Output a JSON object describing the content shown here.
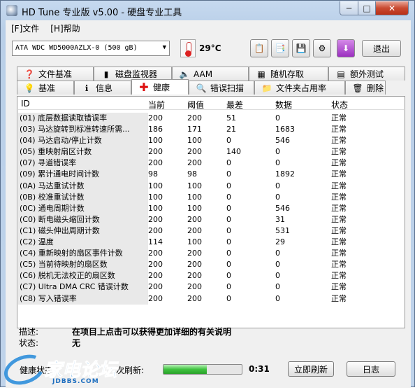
{
  "window": {
    "title": "HD Tune 专业版 v5.00 - 硬盘专业工具",
    "min": "─",
    "max": "□",
    "close": "✕"
  },
  "menu": {
    "file": "[F]文件",
    "help": "[H]帮助"
  },
  "toolbar": {
    "drive": "ATA    WDC WD5000AZLX-0 (500 gB)",
    "temperature": "29°C",
    "exit_label": "退出",
    "icons": [
      "copy-icon",
      "copy-info-icon",
      "save-icon",
      "settings-icon",
      "download-icon"
    ]
  },
  "tabs_top": [
    "文件基准",
    "磁盘监视器",
    "AAM",
    "随机存取",
    "额外测试"
  ],
  "tabs_bottom": [
    "基准",
    "信息",
    "健康",
    "错误扫描",
    "文件夹占用率",
    "删除"
  ],
  "active_tab": "健康",
  "table": {
    "columns": [
      "ID",
      "当前",
      "阈值",
      "最差",
      "数据",
      "状态"
    ],
    "rows": [
      [
        "(01) 底层数据读取错误率",
        "200",
        "200",
        "51",
        "0",
        "正常"
      ],
      [
        "(03) 马达旋转到标准转速所需...",
        "186",
        "171",
        "21",
        "1683",
        "正常"
      ],
      [
        "(04) 马达启动/停止计数",
        "100",
        "100",
        "0",
        "546",
        "正常"
      ],
      [
        "(05) 重映射扇区计数",
        "200",
        "200",
        "140",
        "0",
        "正常"
      ],
      [
        "(07) 寻道错误率",
        "200",
        "200",
        "0",
        "0",
        "正常"
      ],
      [
        "(09) 累计通电时间计数",
        "98",
        "98",
        "0",
        "1892",
        "正常"
      ],
      [
        "(0A) 马达重试计数",
        "100",
        "100",
        "0",
        "0",
        "正常"
      ],
      [
        "(0B) 校准重试计数",
        "100",
        "100",
        "0",
        "0",
        "正常"
      ],
      [
        "(0C) 通电周期计数",
        "100",
        "100",
        "0",
        "546",
        "正常"
      ],
      [
        "(C0) 断电磁头缩回计数",
        "200",
        "200",
        "0",
        "31",
        "正常"
      ],
      [
        "(C1) 磁头伸出周期计数",
        "200",
        "200",
        "0",
        "531",
        "正常"
      ],
      [
        "(C2) 温度",
        "114",
        "100",
        "0",
        "29",
        "正常"
      ],
      [
        "(C4) 重新映射的扇区事件计数",
        "200",
        "200",
        "0",
        "0",
        "正常"
      ],
      [
        "(C5) 当前待映射的扇区数",
        "200",
        "200",
        "0",
        "0",
        "正常"
      ],
      [
        "(C6) 脱机无法校正的扇区数",
        "200",
        "200",
        "0",
        "0",
        "正常"
      ],
      [
        "(C7) Ultra DMA CRC 错误计数",
        "200",
        "200",
        "0",
        "0",
        "正常"
      ],
      [
        "(C8) 写入错误率",
        "200",
        "200",
        "0",
        "0",
        "正常"
      ]
    ]
  },
  "description": {
    "label": "描述:",
    "value": "在项目上点击可以获得更加详细的有关说明"
  },
  "state": {
    "label": "状态:",
    "value": "无"
  },
  "status_bar": {
    "health_label": "健康状态",
    "next_refresh_label": "次刷新:",
    "progress": 0.55,
    "countdown": "0:31",
    "refresh_now": "立即刷新",
    "log": "日志"
  },
  "watermark": {
    "text": "家电论坛",
    "url": "JDBBS.COM"
  }
}
